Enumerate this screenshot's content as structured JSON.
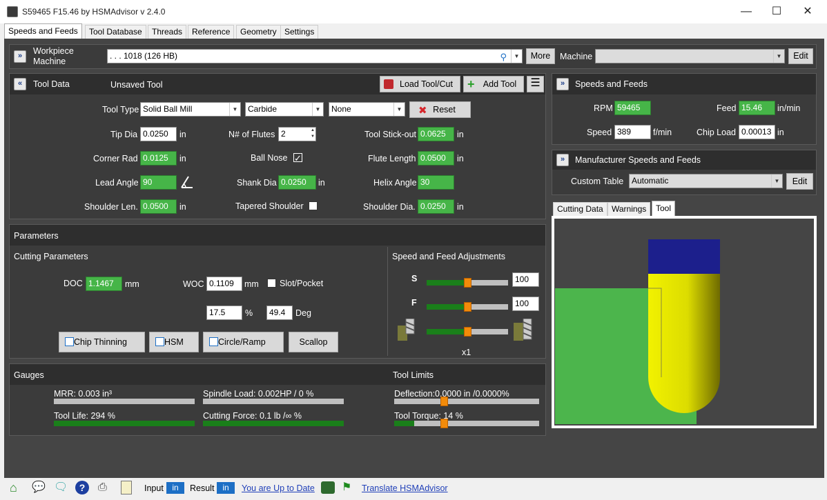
{
  "window": {
    "title": "S59465 F15.46 by HSMAdvisor v 2.4.0",
    "minimize": "—",
    "maximize": "☐",
    "close": "✕"
  },
  "tabs": [
    "Speeds and Feeds",
    "Tool Database",
    "Threads",
    "Reference",
    "Geometry",
    "Settings"
  ],
  "workpiece": {
    "label_line1": "Workpiece",
    "label_line2": "Machine",
    "material": ". . . 1018 (126 HB)",
    "more": "More",
    "machine_label": "Machine",
    "machine_value": "",
    "edit": "Edit"
  },
  "tool_data": {
    "header": "Tool Data",
    "tool_name": "Unsaved Tool",
    "load_btn": "Load Tool/Cut",
    "add_btn": "Add Tool",
    "tool_type_label": "Tool Type",
    "tool_type": "Solid Ball Mill",
    "material": "Carbide",
    "coating": "None",
    "reset": "Reset",
    "tip_dia_label": "Tip Dia",
    "tip_dia": "0.0250",
    "unit_in": "in",
    "flutes_label": "N# of Flutes",
    "flutes": "2",
    "stickout_label": "Tool Stick-out",
    "stickout": "0.0625",
    "corner_label": "Corner Rad",
    "corner": "0.0125",
    "ballnose_label": "Ball Nose",
    "ballnose_checked": "✓",
    "flute_len_label": "Flute Length",
    "flute_len": "0.0500",
    "lead_label": "Lead Angle",
    "lead": "90",
    "shank_label": "Shank Dia",
    "shank": "0.0250",
    "helix_label": "Helix Angle",
    "helix": "30",
    "shoulder_len_label": "Shoulder Len.",
    "shoulder_len": "0.0500",
    "tapered_label": "Tapered Shoulder",
    "shoulder_dia_label": "Shoulder Dia.",
    "shoulder_dia": "0.0250"
  },
  "parameters": {
    "header": "Parameters",
    "cutting_label": "Cutting Parameters",
    "doc_label": "DOC",
    "doc": "1.1467",
    "mm": "mm",
    "woc_label": "WOC",
    "woc": "0.1109",
    "slot_label": "Slot/Pocket",
    "woc_pct": "17.5",
    "pct": "%",
    "deg_val": "49.4",
    "deg": "Deg",
    "chip_thinning": "Chip Thinning",
    "hsm": "HSM",
    "circle": "Circle/Ramp",
    "scallop": "Scallop",
    "adjust_label": "Speed and Feed Adjustments",
    "s_label": "S",
    "f_label": "F",
    "s_val": "100",
    "f_val": "100",
    "mult": "x1",
    "s_level": 0.5,
    "f_level": 0.5,
    "e_level": 0.5
  },
  "gauges": {
    "header": "Gauges",
    "mrr": "MRR: 0.003 in³",
    "spindle": "Spindle Load: 0.002HP / 0 %",
    "life": "Tool Life: 294 %",
    "force": "Cutting Force: 0.1 lb /∞ %",
    "limits_header": "Tool Limits",
    "deflection": "Deflection:0.0000 in /0.0000%",
    "torque": "Tool Torque: 14 %",
    "mrr_level": 0.0,
    "spindle_level": 0.0,
    "life_level": 1.0,
    "force_level": 1.0,
    "deflection_level": 0.0,
    "torque_level": 0.14
  },
  "speeds": {
    "header": "Speeds and Feeds",
    "rpm_label": "RPM",
    "rpm": "59465",
    "feed_label": "Feed",
    "feed": "15.46",
    "feed_unit": "in/min",
    "speed_label": "Speed",
    "speed": "389",
    "speed_unit": "f/min",
    "chip_label": "Chip Load",
    "chip": "0.00013",
    "chip_unit": "in"
  },
  "manufacturer": {
    "header": "Manufacturer Speeds and Feeds",
    "custom_label": "Custom Table",
    "custom_value": "Automatic",
    "edit": "Edit"
  },
  "subtabs": [
    "Cutting Data",
    "Warnings",
    "Tool"
  ],
  "status": {
    "input": "Input",
    "input_unit": "in",
    "result": "Result",
    "result_unit": "in",
    "uptodate": "You are Up to Date",
    "translate": "Translate HSMAdvisor"
  },
  "colors": {
    "green_field": "#46b548",
    "panel": "#3b3b3b",
    "accent_blue": "#1d6fc5",
    "tool_yellow": "#e6e600",
    "tool_shank": "#1c1f8c"
  }
}
